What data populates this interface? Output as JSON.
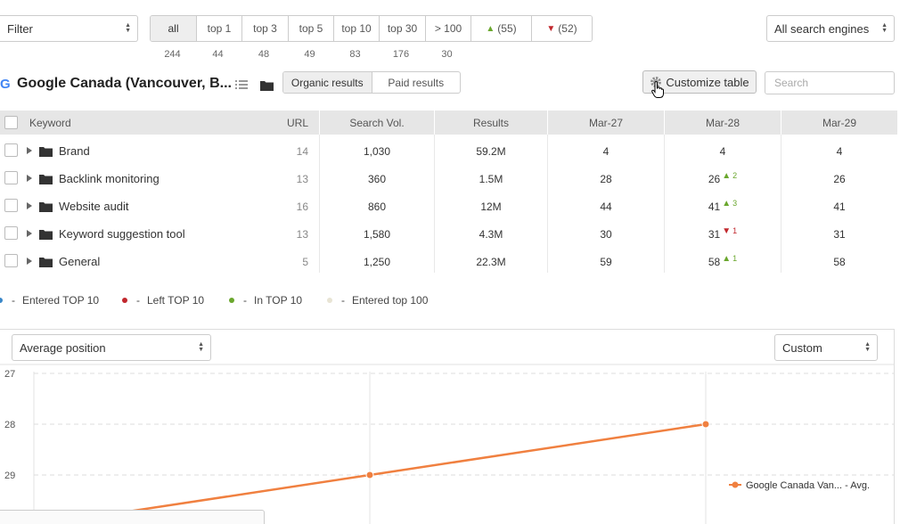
{
  "filter": {
    "label": "Filter"
  },
  "filter_tabs": [
    {
      "label": "all",
      "count": "244"
    },
    {
      "label": "top 1",
      "count": "44"
    },
    {
      "label": "top 3",
      "count": "48"
    },
    {
      "label": "top 5",
      "count": "49"
    },
    {
      "label": "top 10",
      "count": "83"
    },
    {
      "label": "top 30",
      "count": "176"
    },
    {
      "label": "> 100",
      "count": "30"
    },
    {
      "label": "(55)",
      "arrow": "▲"
    },
    {
      "label": "(52)",
      "arrow": "▼"
    }
  ],
  "engines_select": {
    "value": "All search engines"
  },
  "location": {
    "title": "Google Canada (Vancouver, B...",
    "icon": "google-icon"
  },
  "result_tabs": [
    {
      "label": "Organic results"
    },
    {
      "label": "Paid results"
    }
  ],
  "customize_button": {
    "label": "Customize table",
    "icon": "gear-icon"
  },
  "search": {
    "placeholder": "Search"
  },
  "table": {
    "headers": {
      "keyword": "Keyword",
      "url": "URL",
      "search_vol": "Search Vol.",
      "results": "Results",
      "d1": "Mar-27",
      "d2": "Mar-28",
      "d3": "Mar-29"
    },
    "rows": [
      {
        "keyword": "Brand",
        "url": "14",
        "search_vol": "1,030",
        "results": "59.2M",
        "d1": "4",
        "d2": "4",
        "d2_change": "",
        "d2_dir": "",
        "d3": "4"
      },
      {
        "keyword": "Backlink monitoring",
        "url": "13",
        "search_vol": "360",
        "results": "1.5M",
        "d1": "28",
        "d2": "26",
        "d2_change": "2",
        "d2_dir": "up",
        "d3": "26"
      },
      {
        "keyword": "Website audit",
        "url": "16",
        "search_vol": "860",
        "results": "12M",
        "d1": "44",
        "d2": "41",
        "d2_change": "3",
        "d2_dir": "up",
        "d3": "41"
      },
      {
        "keyword": "Keyword suggestion tool",
        "url": "13",
        "search_vol": "1,580",
        "results": "4.3M",
        "d1": "30",
        "d2": "31",
        "d2_change": "1",
        "d2_dir": "down",
        "d3": "31"
      },
      {
        "keyword": "General",
        "url": "5",
        "search_vol": "1,250",
        "results": "22.3M",
        "d1": "59",
        "d2": "58",
        "d2_change": "1",
        "d2_dir": "up",
        "d3": "58"
      }
    ]
  },
  "legend": [
    {
      "label": "Entered TOP 10",
      "color": "#3a87c8"
    },
    {
      "label": "Left TOP 10",
      "color": "#c1272d"
    },
    {
      "label": "In TOP 10",
      "color": "#6aa72d"
    },
    {
      "label": "Entered top 100",
      "color": "#e8e4d4"
    }
  ],
  "chart_controls": {
    "metric": "Average position",
    "range": "Custom"
  },
  "colors": {
    "series": "#f08040",
    "up": "#6aa72d",
    "down": "#c1272d"
  },
  "chart_data": {
    "type": "line",
    "y_ticks": [
      "27",
      "28",
      "29"
    ],
    "ylim": [
      27,
      30
    ],
    "y_inverted": true,
    "series": [
      {
        "name": "Google Canada Van... - Avg.",
        "values": [
          30,
          29,
          28
        ]
      }
    ]
  }
}
